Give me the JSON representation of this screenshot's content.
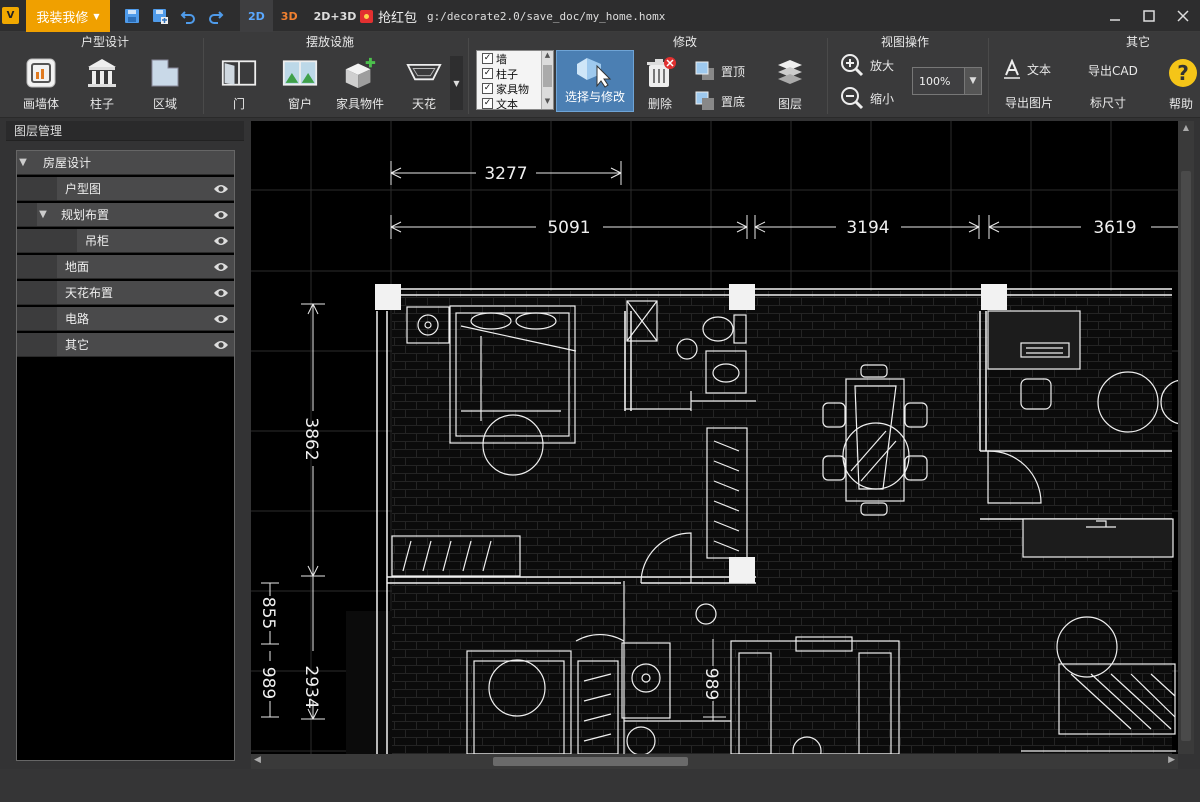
{
  "titlebar": {
    "logo": "V",
    "menu_label": "我装我修",
    "tabs": [
      "2D",
      "3D",
      "2D+3D"
    ],
    "red_packet_label": "抢红包",
    "file_path": "g:/decorate2.0/save_doc/my_home.homx"
  },
  "ribbon": {
    "groups": {
      "house": "户型设计",
      "facilities": "摆放设施",
      "modify": "修改",
      "view": "视图操作",
      "other": "其它"
    },
    "house_buttons": [
      "画墙体",
      "柱子",
      "区域"
    ],
    "facility_buttons": [
      "门",
      "窗户",
      "家具物件",
      "天花"
    ],
    "layer_checklist": [
      "墙",
      "柱子",
      "家具物",
      "文本"
    ],
    "select_label": "选择与修改",
    "delete_label": "删除",
    "top_label": "置顶",
    "bottom_label": "置底",
    "layer_label": "图层",
    "zoom_in_label": "放大",
    "zoom_out_label": "缩小",
    "zoom_value": "100%",
    "text_label": "文本",
    "export_cad_label": "导出CAD",
    "export_image_label": "导出图片",
    "dimension_label": "标尺寸",
    "help_label": "帮助"
  },
  "layers_panel": {
    "title": "图层管理",
    "items": [
      {
        "label": "房屋设计",
        "level": 0,
        "expanded": true
      },
      {
        "label": "户型图",
        "level": 1
      },
      {
        "label": "规划布置",
        "level": 1,
        "expanded": true
      },
      {
        "label": "吊柜",
        "level": 2
      },
      {
        "label": "地面",
        "level": 1
      },
      {
        "label": "天花布置",
        "level": 1
      },
      {
        "label": "电路",
        "level": 1
      },
      {
        "label": "其它",
        "level": 1
      }
    ]
  },
  "plan": {
    "dimensions": {
      "top1": "3277",
      "top2": "5091",
      "top3": "3194",
      "top4": "3619",
      "left1": "3862",
      "left2": "855",
      "left3": "989",
      "left4": "2934",
      "mid": "989"
    }
  }
}
